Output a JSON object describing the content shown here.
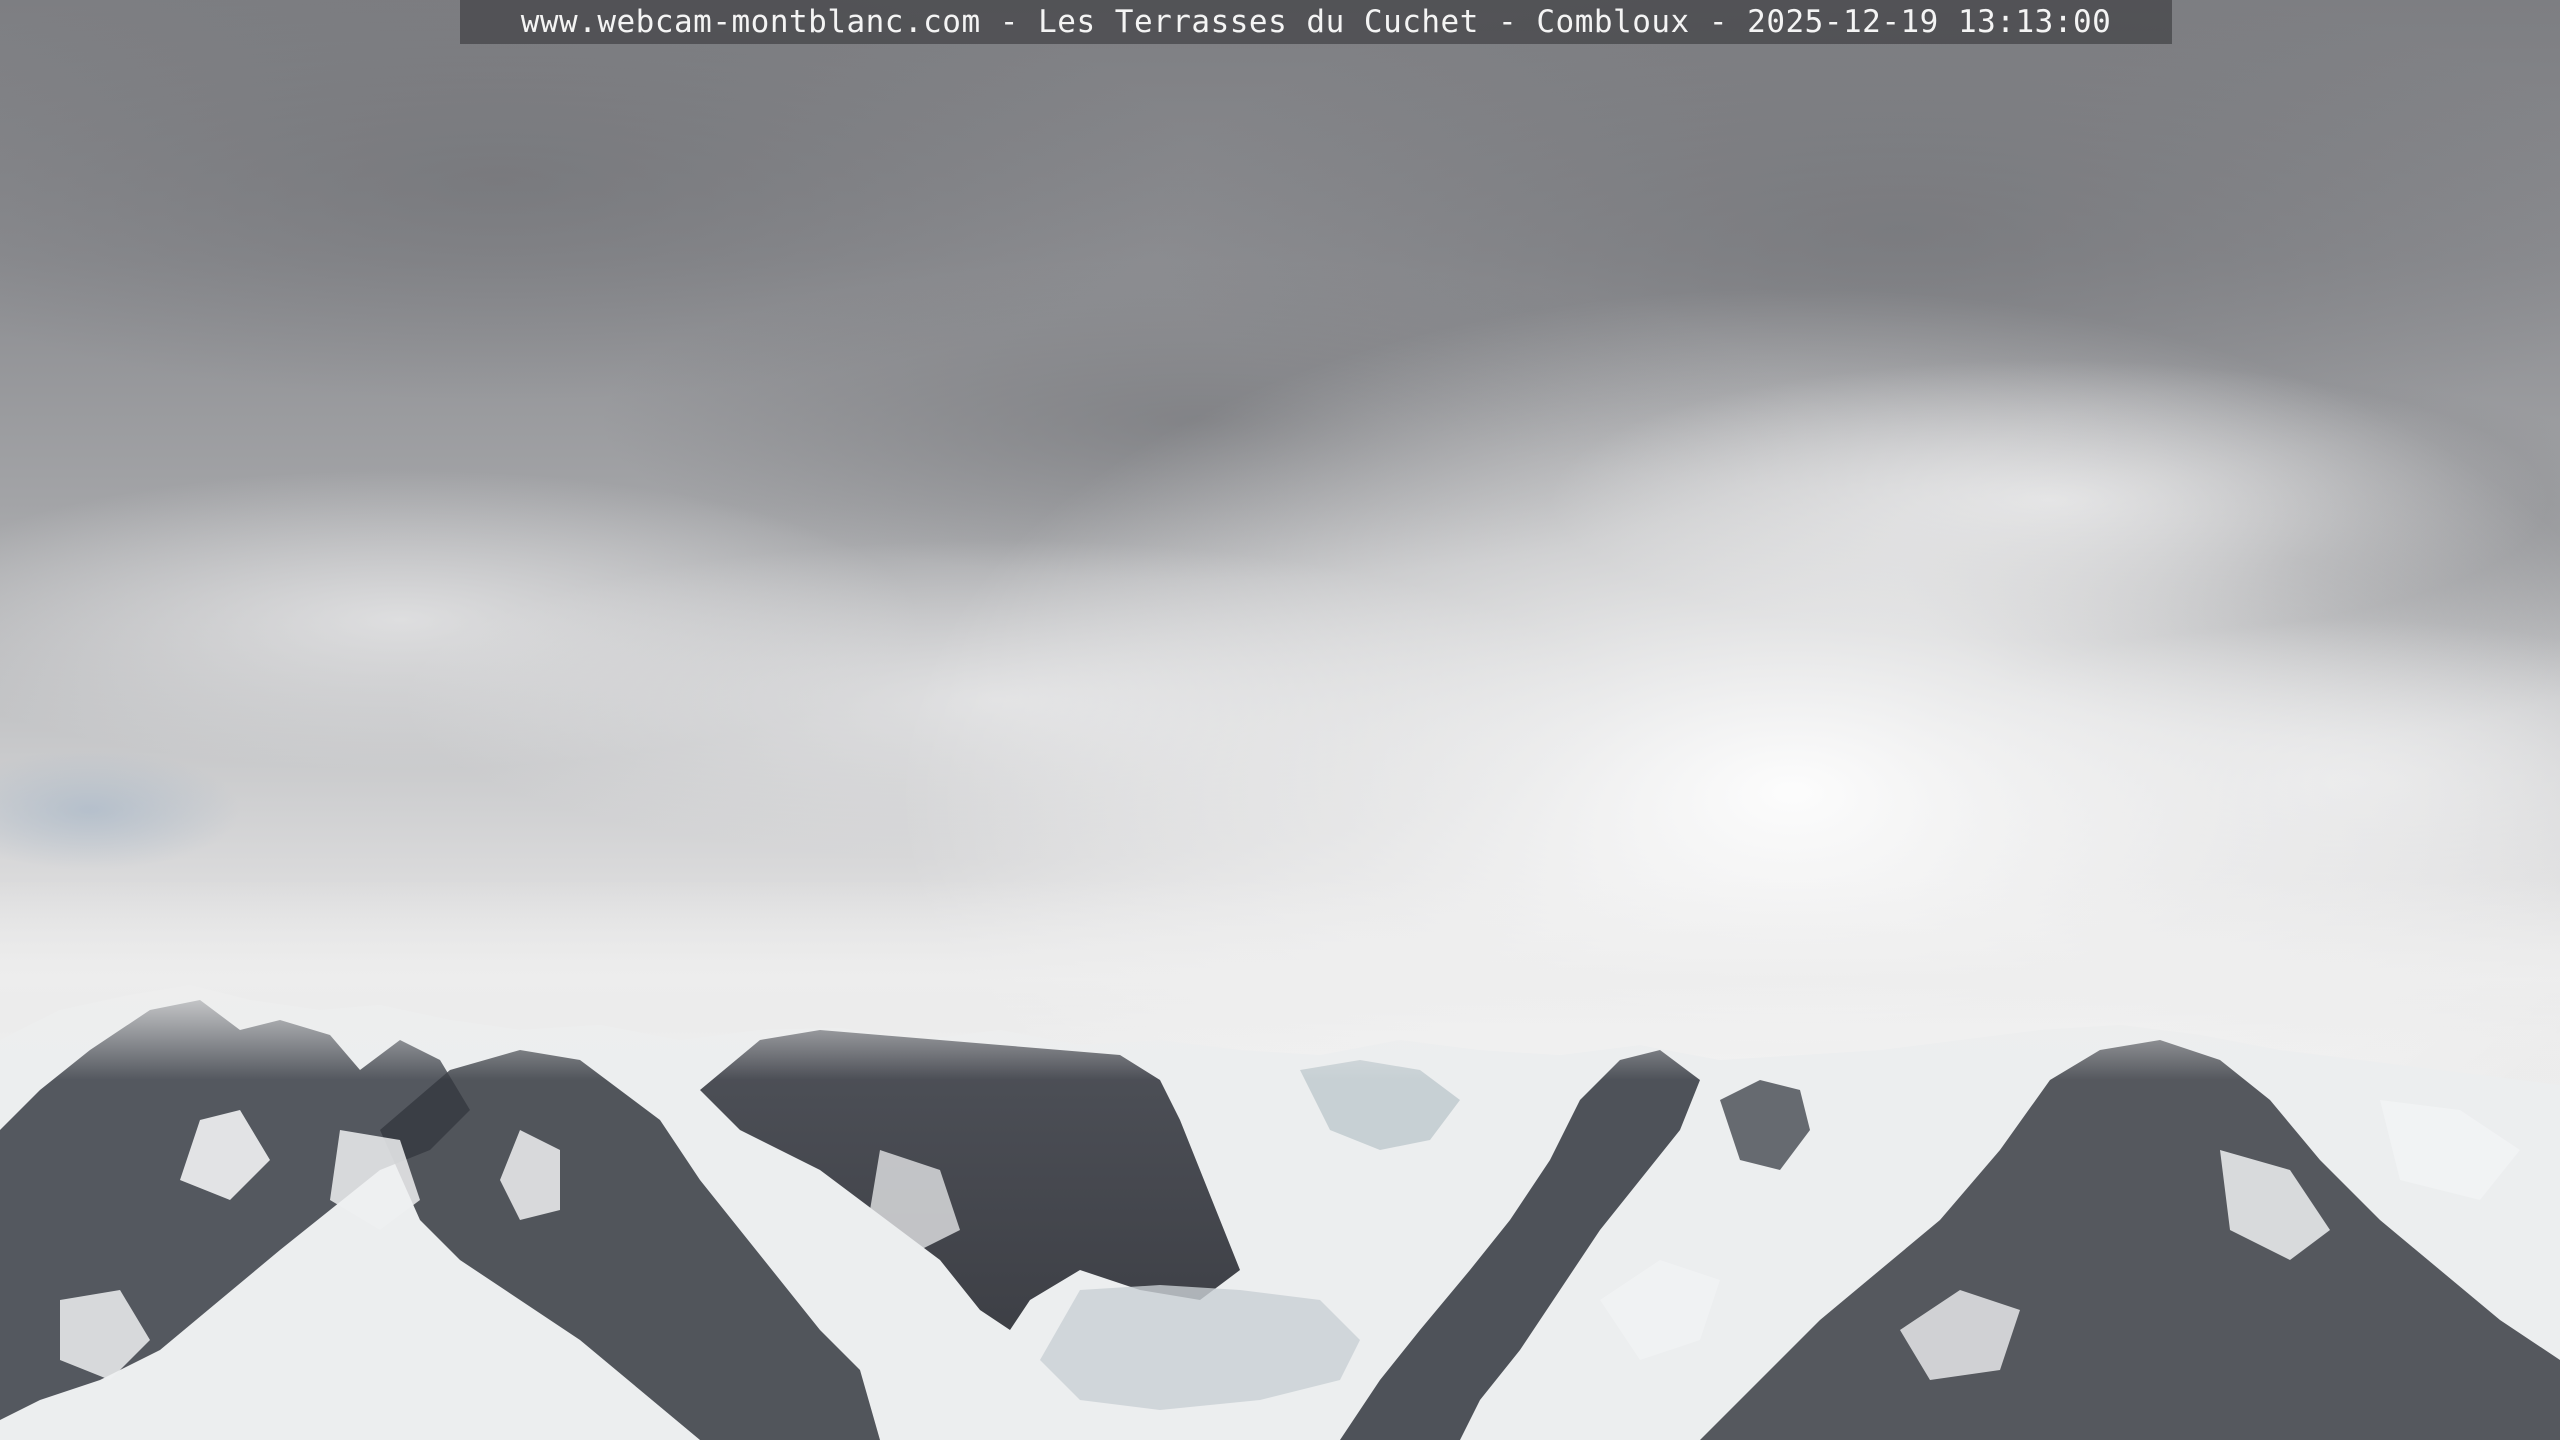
{
  "caption": "www.webcam-montblanc.com - Les Terrasses du Cuchet - Combloux - 2025-12-19 13:13:00"
}
